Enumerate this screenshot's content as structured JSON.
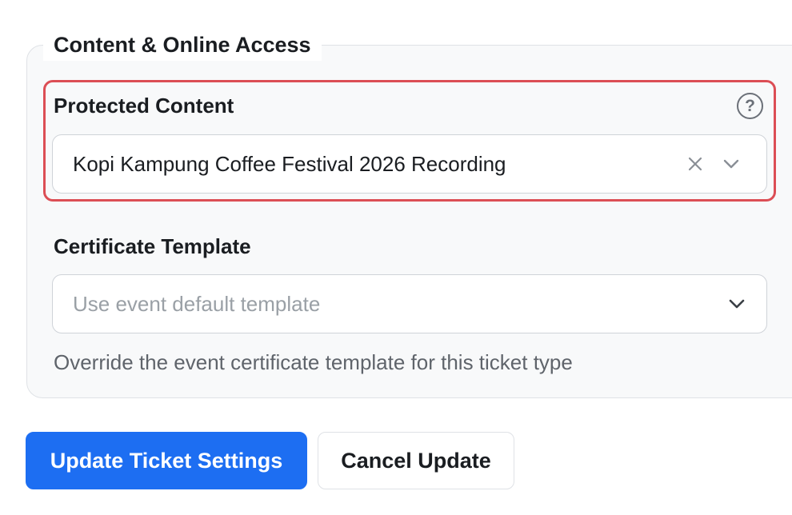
{
  "section": {
    "legend": "Content & Online Access"
  },
  "protected_content": {
    "label": "Protected Content",
    "help_icon": "question-circle-icon",
    "value": "Kopi Kampung Coffee Festival 2026 Recording",
    "clear_icon": "close-icon",
    "dropdown_icon": "chevron-down-icon"
  },
  "certificate_template": {
    "label": "Certificate Template",
    "placeholder": "Use event default template",
    "dropdown_icon": "chevron-down-icon",
    "helper": "Override the event certificate template for this ticket type"
  },
  "actions": {
    "primary_label": "Update Ticket Settings",
    "secondary_label": "Cancel Update"
  },
  "colors": {
    "accent": "#1d6ef2",
    "highlight": "#dc4e55"
  }
}
